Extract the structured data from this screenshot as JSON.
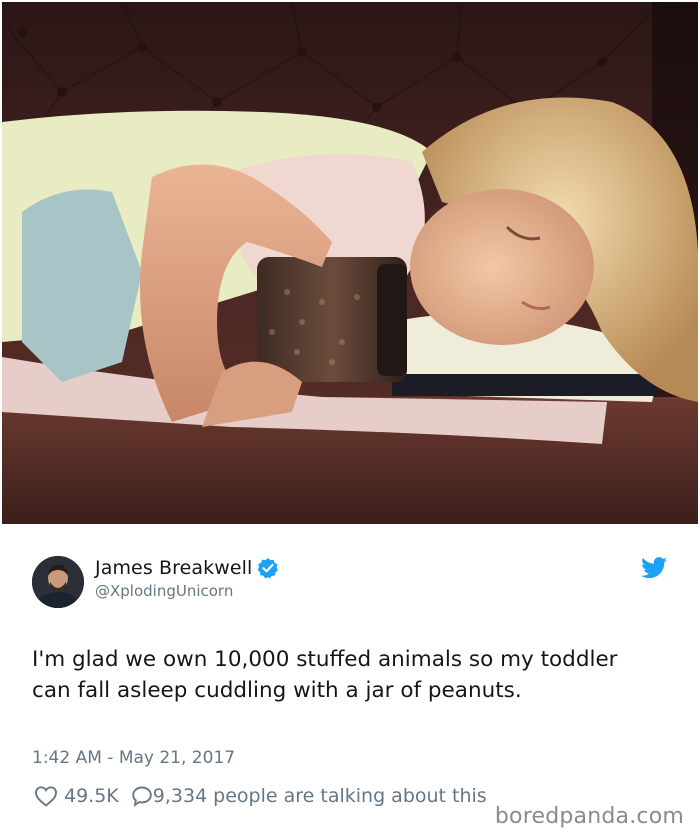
{
  "photo": {
    "icon": "photo-of-sleeping-toddler-hugging-peanut-jar"
  },
  "tweet": {
    "author": {
      "display_name": "James Breakwell",
      "handle": "@XplodingUnicorn",
      "verified": true
    },
    "text": "I'm glad we own 10,000 stuffed animals so my toddler can fall asleep cuddling with a jar of peanuts.",
    "timestamp": "1:42 AM - May 21, 2017",
    "likes": "49.5K",
    "replies": "9,334",
    "talking_text": "people are talking about this"
  },
  "watermark": {
    "text": "boredpanda.com"
  },
  "colors": {
    "twitter_blue": "#1da1f2",
    "text_primary": "#14171a",
    "text_secondary": "#657786",
    "watermark": "#8a8a8a"
  }
}
